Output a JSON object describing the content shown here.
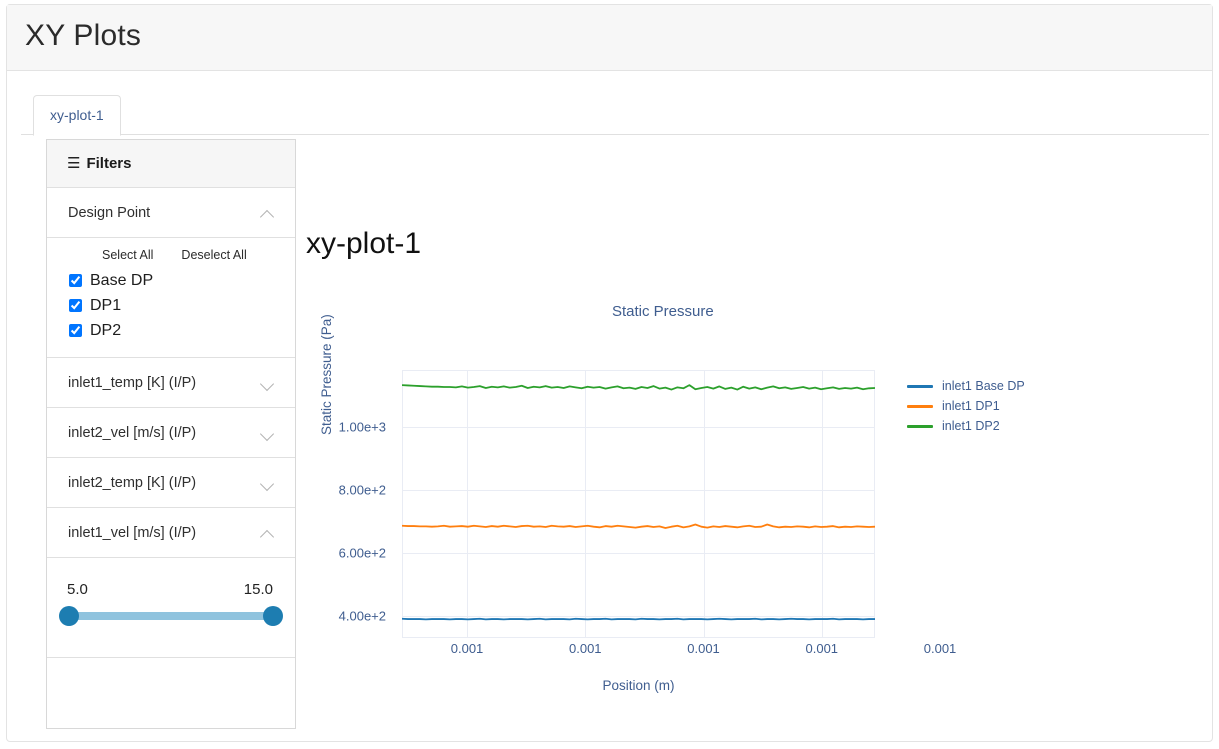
{
  "app": {
    "title": "XY Plots"
  },
  "tabs": [
    {
      "label": "xy-plot-1",
      "active": true
    }
  ],
  "sidebar": {
    "header": {
      "menu_icon": "hamburger-icon",
      "title": "Filters"
    },
    "design_point": {
      "label": "Design Point",
      "expanded": true,
      "chevron": "chevron-up-icon",
      "select_all_label": "Select All",
      "deselect_all_label": "Deselect All",
      "options": [
        {
          "label": "Base DP",
          "checked": true
        },
        {
          "label": "DP1",
          "checked": true
        },
        {
          "label": "DP2",
          "checked": true
        }
      ]
    },
    "parameters": [
      {
        "label": "inlet1_temp [K] (I/P)",
        "expanded": false,
        "chevron": "chevron-down-icon"
      },
      {
        "label": "inlet2_vel [m/s] (I/P)",
        "expanded": false,
        "chevron": "chevron-down-icon"
      },
      {
        "label": "inlet2_temp [K] (I/P)",
        "expanded": false,
        "chevron": "chevron-down-icon"
      },
      {
        "label": "inlet1_vel [m/s] (I/P)",
        "expanded": true,
        "chevron": "chevron-up-icon"
      }
    ],
    "slider": {
      "min_label": "5.0",
      "max_label": "15.0",
      "min_value": 5.0,
      "max_value": 15.0,
      "track_color": "#8fc3de",
      "knob_color": "#1d7db1"
    }
  },
  "main": {
    "plot_heading": "xy-plot-1"
  },
  "chart_data": {
    "type": "line",
    "title": "Static Pressure",
    "xlabel": "Position (m)",
    "ylabel": "Static Pressure (Pa)",
    "grid": true,
    "legend_position": "right",
    "xlim": [
      0.0005,
      0.0013
    ],
    "ylim": [
      330,
      1180
    ],
    "yticks": [
      {
        "label": "1.00e+3",
        "value": 1000
      },
      {
        "label": "8.00e+2",
        "value": 800
      },
      {
        "label": "6.00e+2",
        "value": 600
      },
      {
        "label": "4.00e+2",
        "value": 400
      }
    ],
    "xticks": [
      {
        "label": "0.001",
        "value": 0.00061
      },
      {
        "label": "0.001",
        "value": 0.00081
      },
      {
        "label": "0.001",
        "value": 0.00101
      },
      {
        "label": "0.001",
        "value": 0.00121
      },
      {
        "label": "0.001",
        "value": 0.00141
      }
    ],
    "series": [
      {
        "name": "inlet1 Base DP",
        "color": "#1f77b4",
        "mean": 390,
        "values": [
          391,
          390,
          390,
          390,
          389,
          390,
          390,
          390,
          389,
          390,
          390,
          389,
          390,
          391,
          389,
          390,
          390,
          389,
          390,
          390,
          390,
          389,
          390,
          391,
          389,
          390,
          390,
          390,
          389,
          391,
          390,
          389,
          390,
          390,
          391,
          389,
          390,
          390,
          390,
          389,
          391,
          390,
          390,
          389,
          390,
          390,
          391,
          389,
          390,
          390,
          390,
          389,
          390,
          391,
          390,
          389,
          390,
          390,
          390,
          391,
          389,
          390,
          390,
          389,
          390,
          391,
          390,
          390,
          389,
          390,
          390,
          390,
          391,
          389,
          390,
          390,
          390,
          389,
          390,
          390
        ]
      },
      {
        "name": "inlet1 DP1",
        "color": "#ff7f0e",
        "mean": 683,
        "values": [
          686,
          685,
          685,
          684,
          684,
          683,
          684,
          686,
          683,
          684,
          685,
          683,
          686,
          684,
          682,
          685,
          683,
          686,
          684,
          682,
          685,
          686,
          683,
          684,
          682,
          686,
          684,
          683,
          685,
          682,
          684,
          686,
          683,
          681,
          685,
          683,
          686,
          684,
          682,
          680,
          683,
          685,
          682,
          684,
          679,
          683,
          686,
          681,
          684,
          690,
          683,
          680,
          684,
          682,
          685,
          683,
          681,
          684,
          686,
          682,
          683,
          690,
          684,
          681,
          683,
          682,
          684,
          683,
          681,
          684,
          682,
          683,
          685,
          681,
          683,
          682,
          684,
          683,
          682,
          683
        ]
      },
      {
        "name": "inlet1 DP2",
        "color": "#2ca02c",
        "mean": 1124,
        "values": [
          1132,
          1131,
          1130,
          1129,
          1128,
          1127,
          1127,
          1126,
          1126,
          1125,
          1128,
          1124,
          1126,
          1129,
          1123,
          1127,
          1125,
          1128,
          1124,
          1126,
          1130,
          1123,
          1127,
          1125,
          1129,
          1124,
          1126,
          1123,
          1128,
          1125,
          1122,
          1127,
          1124,
          1126,
          1121,
          1125,
          1128,
          1122,
          1124,
          1120,
          1126,
          1123,
          1129,
          1121,
          1124,
          1118,
          1125,
          1122,
          1132,
          1119,
          1123,
          1126,
          1121,
          1128,
          1120,
          1124,
          1118,
          1127,
          1121,
          1125,
          1119,
          1124,
          1128,
          1122,
          1125,
          1120,
          1123,
          1126,
          1121,
          1124,
          1119,
          1122,
          1125,
          1120,
          1123,
          1121,
          1124,
          1119,
          1122,
          1123
        ]
      }
    ]
  }
}
